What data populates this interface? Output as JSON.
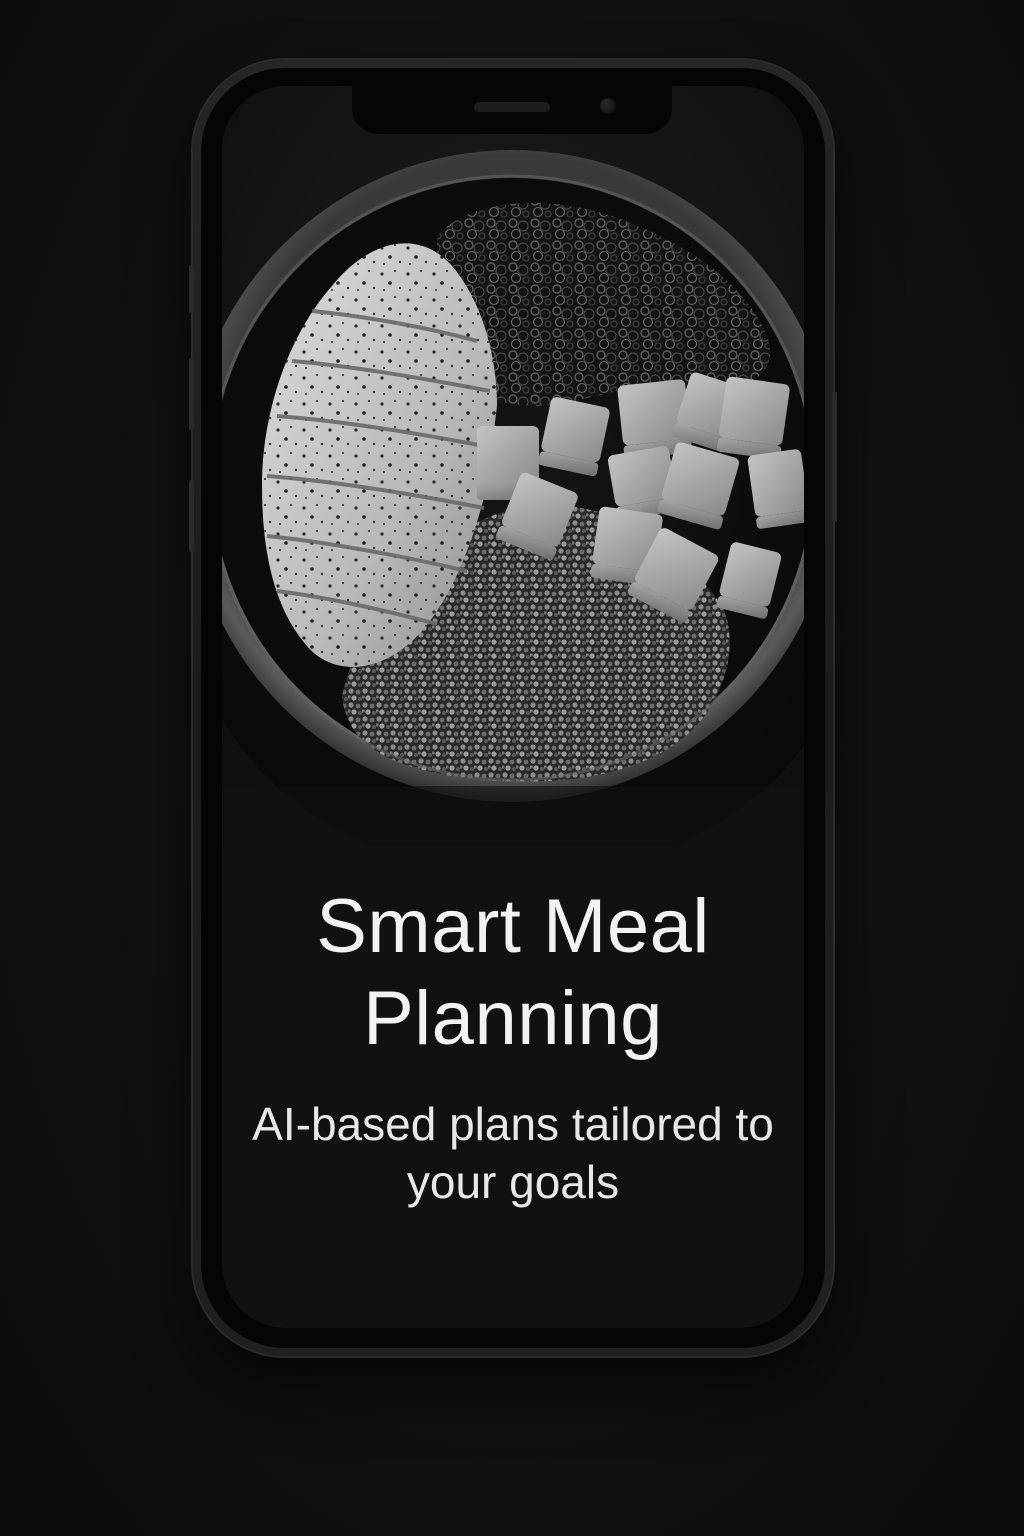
{
  "onboarding": {
    "title": "Smart Meal Planning",
    "subtitle": "AI-based plans tailored to your goals",
    "hero_image": "grayscale-bowl-chicken-kale-tofu-quinoa"
  },
  "colors": {
    "background": "#111111",
    "phone_frame": "#222222",
    "text": "#f2f2f2"
  }
}
